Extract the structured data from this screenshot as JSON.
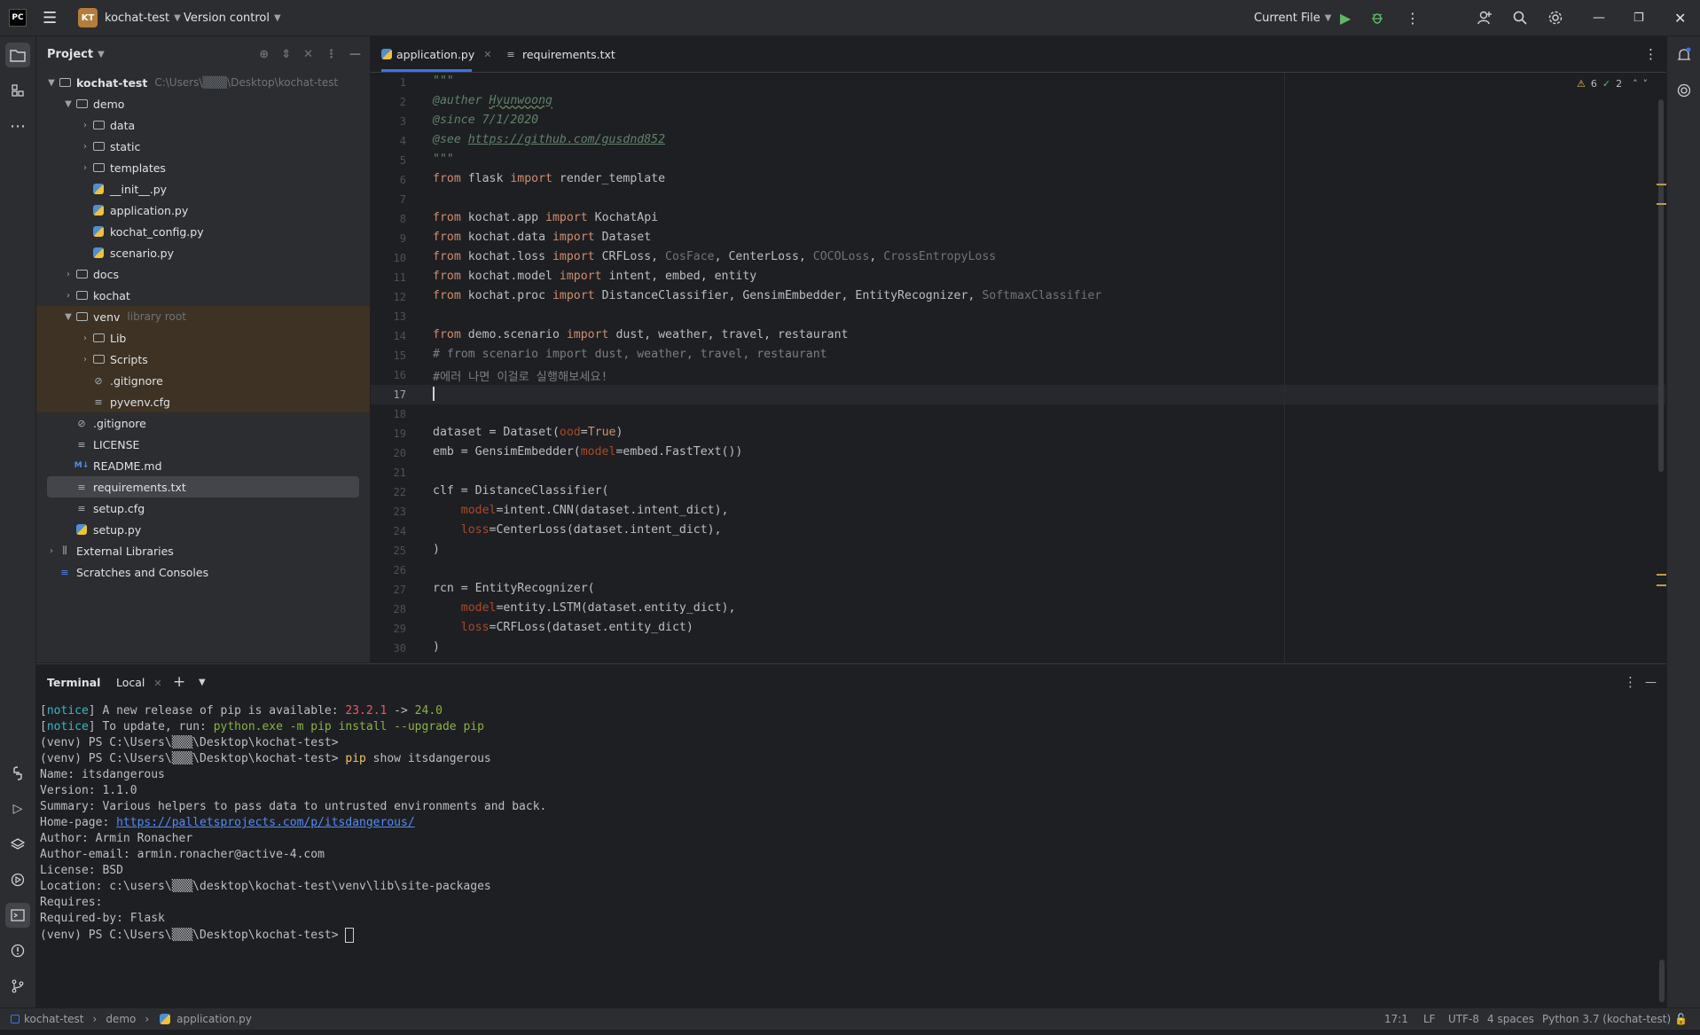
{
  "titlebar": {
    "app_logo": "PC",
    "project_badge": "KT",
    "project_name": "kochat-test",
    "vcs": "Version control",
    "run_config": "Current File"
  },
  "project_panel": {
    "title": "Project",
    "tree": [
      {
        "label": "kochat-test",
        "hint": "C:\\Users\\▒▒▒\\Desktop\\kochat-test",
        "kind": "folder",
        "expanded": true
      },
      {
        "label": "demo",
        "kind": "folder",
        "expanded": true
      },
      {
        "label": "data",
        "kind": "folder"
      },
      {
        "label": "static",
        "kind": "folder"
      },
      {
        "label": "templates",
        "kind": "folder"
      },
      {
        "label": "__init__.py",
        "kind": "py"
      },
      {
        "label": "application.py",
        "kind": "py"
      },
      {
        "label": "kochat_config.py",
        "kind": "py"
      },
      {
        "label": "scenario.py",
        "kind": "py"
      },
      {
        "label": "docs",
        "kind": "folder"
      },
      {
        "label": "kochat",
        "kind": "folder"
      },
      {
        "label": "venv",
        "hint": "library root",
        "kind": "folder",
        "expanded": true
      },
      {
        "label": "Lib",
        "kind": "folder"
      },
      {
        "label": "Scripts",
        "kind": "folder"
      },
      {
        "label": ".gitignore",
        "kind": "ignore"
      },
      {
        "label": "pyvenv.cfg",
        "kind": "text"
      },
      {
        "label": ".gitignore",
        "kind": "ignore"
      },
      {
        "label": "LICENSE",
        "kind": "text"
      },
      {
        "label": "README.md",
        "kind": "md"
      },
      {
        "label": "requirements.txt",
        "kind": "text"
      },
      {
        "label": "setup.cfg",
        "kind": "text"
      },
      {
        "label": "setup.py",
        "kind": "py"
      },
      {
        "label": "External Libraries",
        "kind": "lib"
      },
      {
        "label": "Scratches and Consoles",
        "kind": "scratch"
      }
    ]
  },
  "tabs": [
    {
      "label": "application.py",
      "active": true
    },
    {
      "label": "requirements.txt",
      "active": false
    }
  ],
  "inspections": {
    "warnings": "6",
    "weak": "2"
  },
  "editor": {
    "current_line": 17,
    "line_numbers": [
      "1",
      "2",
      "3",
      "4",
      "5",
      "6",
      "7",
      "8",
      "9",
      "10",
      "11",
      "12",
      "13",
      "14",
      "15",
      "16",
      "17",
      "18",
      "19",
      "20",
      "21",
      "22",
      "23",
      "24",
      "25",
      "26",
      "27",
      "28",
      "29",
      "30"
    ],
    "lines": [
      [
        [
          "doc",
          "\"\"\""
        ]
      ],
      [
        [
          "doc",
          "@auther "
        ],
        [
          "doc-u",
          "Hyunwoong"
        ]
      ],
      [
        [
          "doc",
          "@since 7/1/2020"
        ]
      ],
      [
        [
          "doc",
          "@see "
        ],
        [
          "doc-link",
          "https://github.com/gusdnd852"
        ]
      ],
      [
        [
          "doc",
          "\"\"\""
        ]
      ],
      [
        [
          "kw",
          "from "
        ],
        [
          "",
          "flask "
        ],
        [
          "kw",
          "import "
        ],
        [
          "",
          "render_template"
        ]
      ],
      [],
      [
        [
          "kw",
          "from "
        ],
        [
          "",
          "kochat.app "
        ],
        [
          "kw",
          "import "
        ],
        [
          "",
          "KochatApi"
        ]
      ],
      [
        [
          "kw",
          "from "
        ],
        [
          "",
          "kochat.data "
        ],
        [
          "kw",
          "import "
        ],
        [
          "",
          "Dataset"
        ]
      ],
      [
        [
          "kw",
          "from "
        ],
        [
          "",
          "kochat.loss "
        ],
        [
          "kw",
          "import "
        ],
        [
          "",
          "CRFLoss, "
        ],
        [
          "dim",
          "CosFace"
        ],
        [
          "",
          ", CenterLoss, "
        ],
        [
          "dim",
          "COCOLoss"
        ],
        [
          "",
          ", "
        ],
        [
          "dim",
          "CrossEntropyLoss"
        ]
      ],
      [
        [
          "kw",
          "from "
        ],
        [
          "",
          "kochat.model "
        ],
        [
          "kw",
          "import "
        ],
        [
          "",
          "intent, embed, entity"
        ]
      ],
      [
        [
          "kw",
          "from "
        ],
        [
          "",
          "kochat.proc "
        ],
        [
          "kw",
          "import "
        ],
        [
          "",
          "DistanceClassifier, GensimEmbedder, EntityRecognizer, "
        ],
        [
          "dim",
          "SoftmaxClassifier"
        ]
      ],
      [],
      [
        [
          "kw",
          "from "
        ],
        [
          "",
          "demo.scenario "
        ],
        [
          "kw",
          "import "
        ],
        [
          "",
          "dust, weather, travel, restaurant"
        ]
      ],
      [
        [
          "cmt",
          "# from scenario import dust, weather, travel, restaurant"
        ]
      ],
      [
        [
          "cmt",
          "#에러 나면 이걸로 실행해보세요!"
        ]
      ],
      [],
      [],
      [
        [
          "",
          "dataset = Dataset("
        ],
        [
          "param",
          "ood"
        ],
        [
          "",
          "="
        ],
        [
          "kw",
          "True"
        ],
        [
          "",
          ")"
        ]
      ],
      [
        [
          "",
          "emb = GensimEmbedder("
        ],
        [
          "param",
          "model"
        ],
        [
          "",
          "=embed.FastText())"
        ]
      ],
      [],
      [
        [
          "",
          "clf = DistanceClassifier("
        ]
      ],
      [
        [
          "",
          "    "
        ],
        [
          "param",
          "model"
        ],
        [
          "",
          "=intent.CNN(dataset.intent_dict),"
        ]
      ],
      [
        [
          "",
          "    "
        ],
        [
          "param",
          "loss"
        ],
        [
          "",
          "=CenterLoss(dataset.intent_dict),"
        ]
      ],
      [
        [
          "",
          ")"
        ]
      ],
      [],
      [
        [
          "",
          "rcn = EntityRecognizer("
        ]
      ],
      [
        [
          "",
          "    "
        ],
        [
          "param",
          "model"
        ],
        [
          "",
          "=entity.LSTM(dataset.entity_dict),"
        ]
      ],
      [
        [
          "",
          "    "
        ],
        [
          "param",
          "loss"
        ],
        [
          "",
          "=CRFLoss(dataset.entity_dict)"
        ]
      ],
      [
        [
          "",
          ")"
        ]
      ]
    ]
  },
  "terminal": {
    "title": "Terminal",
    "tab": "Local",
    "lines": [
      [
        [
          "",
          "["
        ],
        [
          "t-cyan",
          "notice"
        ],
        [
          "",
          "] A new release of pip is available: "
        ],
        [
          "t-red",
          "23.2.1"
        ],
        [
          "",
          " -> "
        ],
        [
          "t-green",
          "24.0"
        ]
      ],
      [
        [
          "",
          "["
        ],
        [
          "t-cyan",
          "notice"
        ],
        [
          "",
          "] To update, run: "
        ],
        [
          "t-green",
          "python.exe -m pip install --upgrade pip"
        ]
      ],
      [
        [
          "",
          "(venv) PS C:\\Users\\▒▒▒\\Desktop\\kochat-test>"
        ]
      ],
      [
        [
          "",
          "(venv) PS C:\\Users\\▒▒▒\\Desktop\\kochat-test> "
        ],
        [
          "t-yellow",
          "pip"
        ],
        [
          "",
          " show itsdangerous"
        ]
      ],
      [
        [
          "",
          "Name: itsdangerous"
        ]
      ],
      [
        [
          "",
          "Version: 1.1.0"
        ]
      ],
      [
        [
          "",
          "Summary: Various helpers to pass data to untrusted environments and back."
        ]
      ],
      [
        [
          "",
          "Home-page: "
        ],
        [
          "t-link",
          "https://palletsprojects.com/p/itsdangerous/"
        ]
      ],
      [
        [
          "",
          "Author: Armin Ronacher"
        ]
      ],
      [
        [
          "",
          "Author-email: armin.ronacher@active-4.com"
        ]
      ],
      [
        [
          "",
          "License: BSD"
        ]
      ],
      [
        [
          "",
          "Location: c:\\users\\▒▒▒\\desktop\\kochat-test\\venv\\lib\\site-packages"
        ]
      ],
      [
        [
          "",
          "Requires:"
        ]
      ],
      [
        [
          "",
          "Required-by: Flask"
        ]
      ],
      [
        [
          "",
          "(venv) PS C:\\Users\\▒▒▒\\Desktop\\kochat-test> "
        ]
      ]
    ]
  },
  "statusbar": {
    "crumbs": [
      "kochat-test",
      "demo",
      "application.py"
    ],
    "position": "17:1",
    "line_sep": "LF",
    "encoding": "UTF-8",
    "indent": "4 spaces",
    "interpreter": "Python 3.7 (kochat-test)"
  }
}
